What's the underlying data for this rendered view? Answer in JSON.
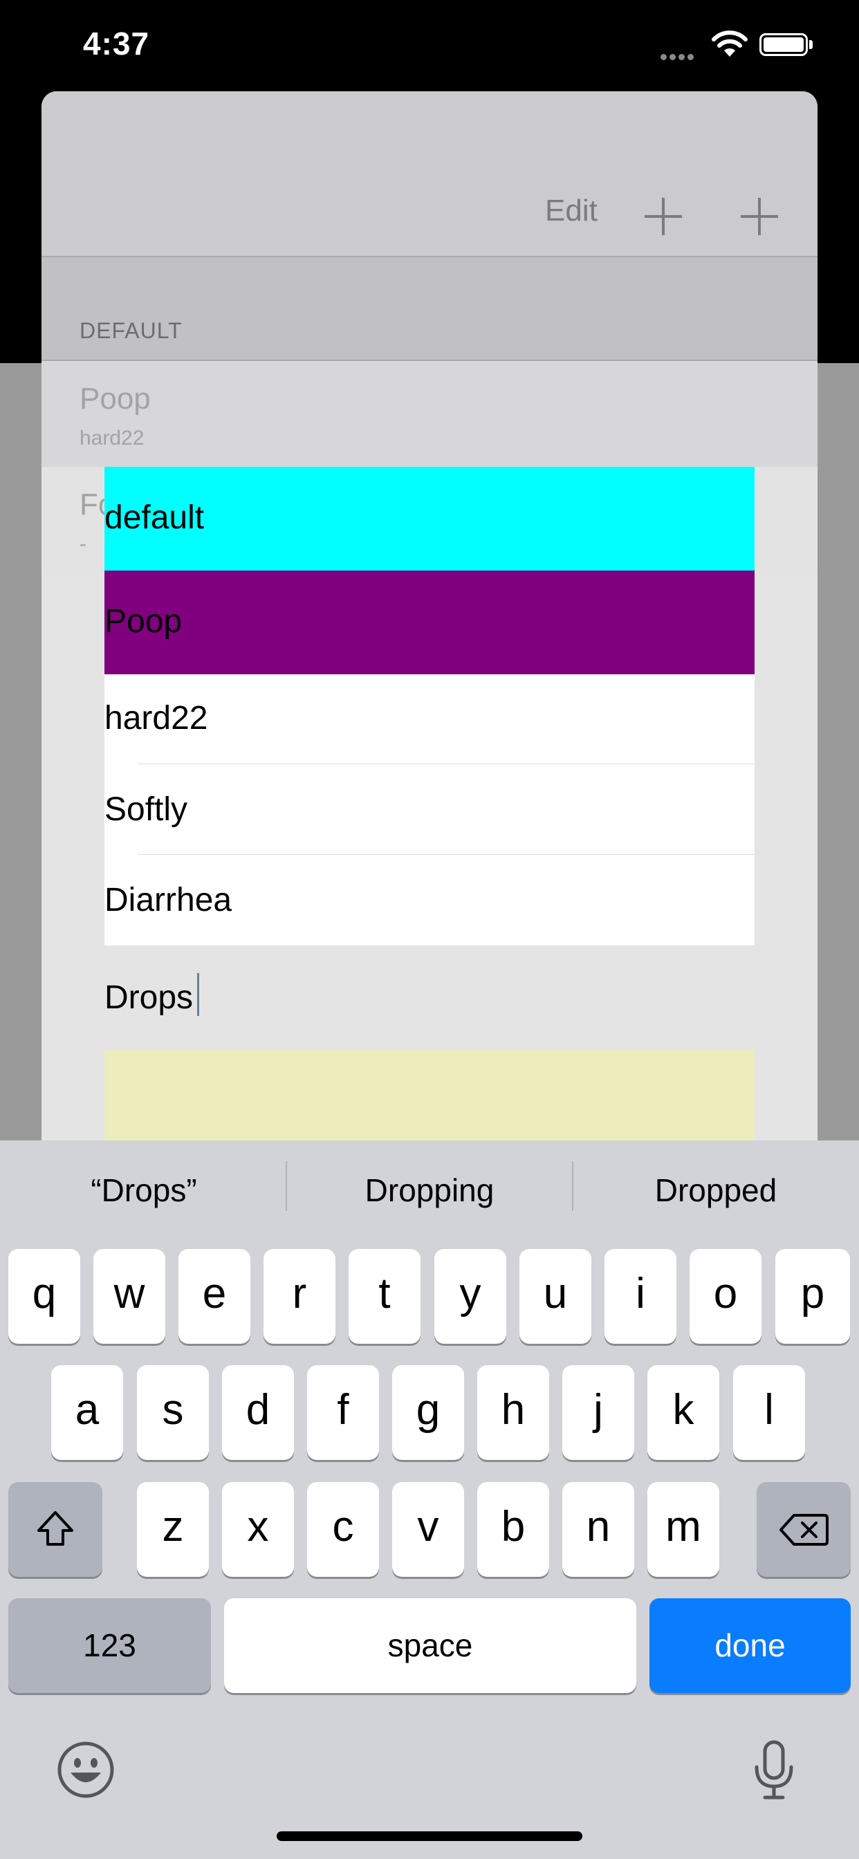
{
  "status_bar": {
    "time": "4:37"
  },
  "navbar": {
    "edit_label": "Edit"
  },
  "list": {
    "section_header": "DEFAULT",
    "rows": [
      {
        "title": "Poop",
        "subtitle": "hard22"
      },
      {
        "title": "Fo",
        "subtitle": "-"
      }
    ]
  },
  "dropdown": {
    "options": [
      "default",
      "Poop",
      "hard22",
      "Softly",
      "Diarrhea"
    ],
    "colors": {
      "default": "#00ffff",
      "Poop": "#800080",
      "highlight": "#ececbc"
    }
  },
  "input": {
    "value": "Drops"
  },
  "keyboard": {
    "suggestions": [
      "“Drops”",
      "Dropping",
      "Dropped"
    ],
    "row1": [
      "q",
      "w",
      "e",
      "r",
      "t",
      "y",
      "u",
      "i",
      "o",
      "p"
    ],
    "row2": [
      "a",
      "s",
      "d",
      "f",
      "g",
      "h",
      "j",
      "k",
      "l"
    ],
    "row3": [
      "z",
      "x",
      "c",
      "v",
      "b",
      "n",
      "m"
    ],
    "numbers_label": "123",
    "space_label": "space",
    "done_label": "done",
    "icons": [
      "shift-icon",
      "delete-icon",
      "emoji-icon",
      "microphone-icon"
    ]
  }
}
